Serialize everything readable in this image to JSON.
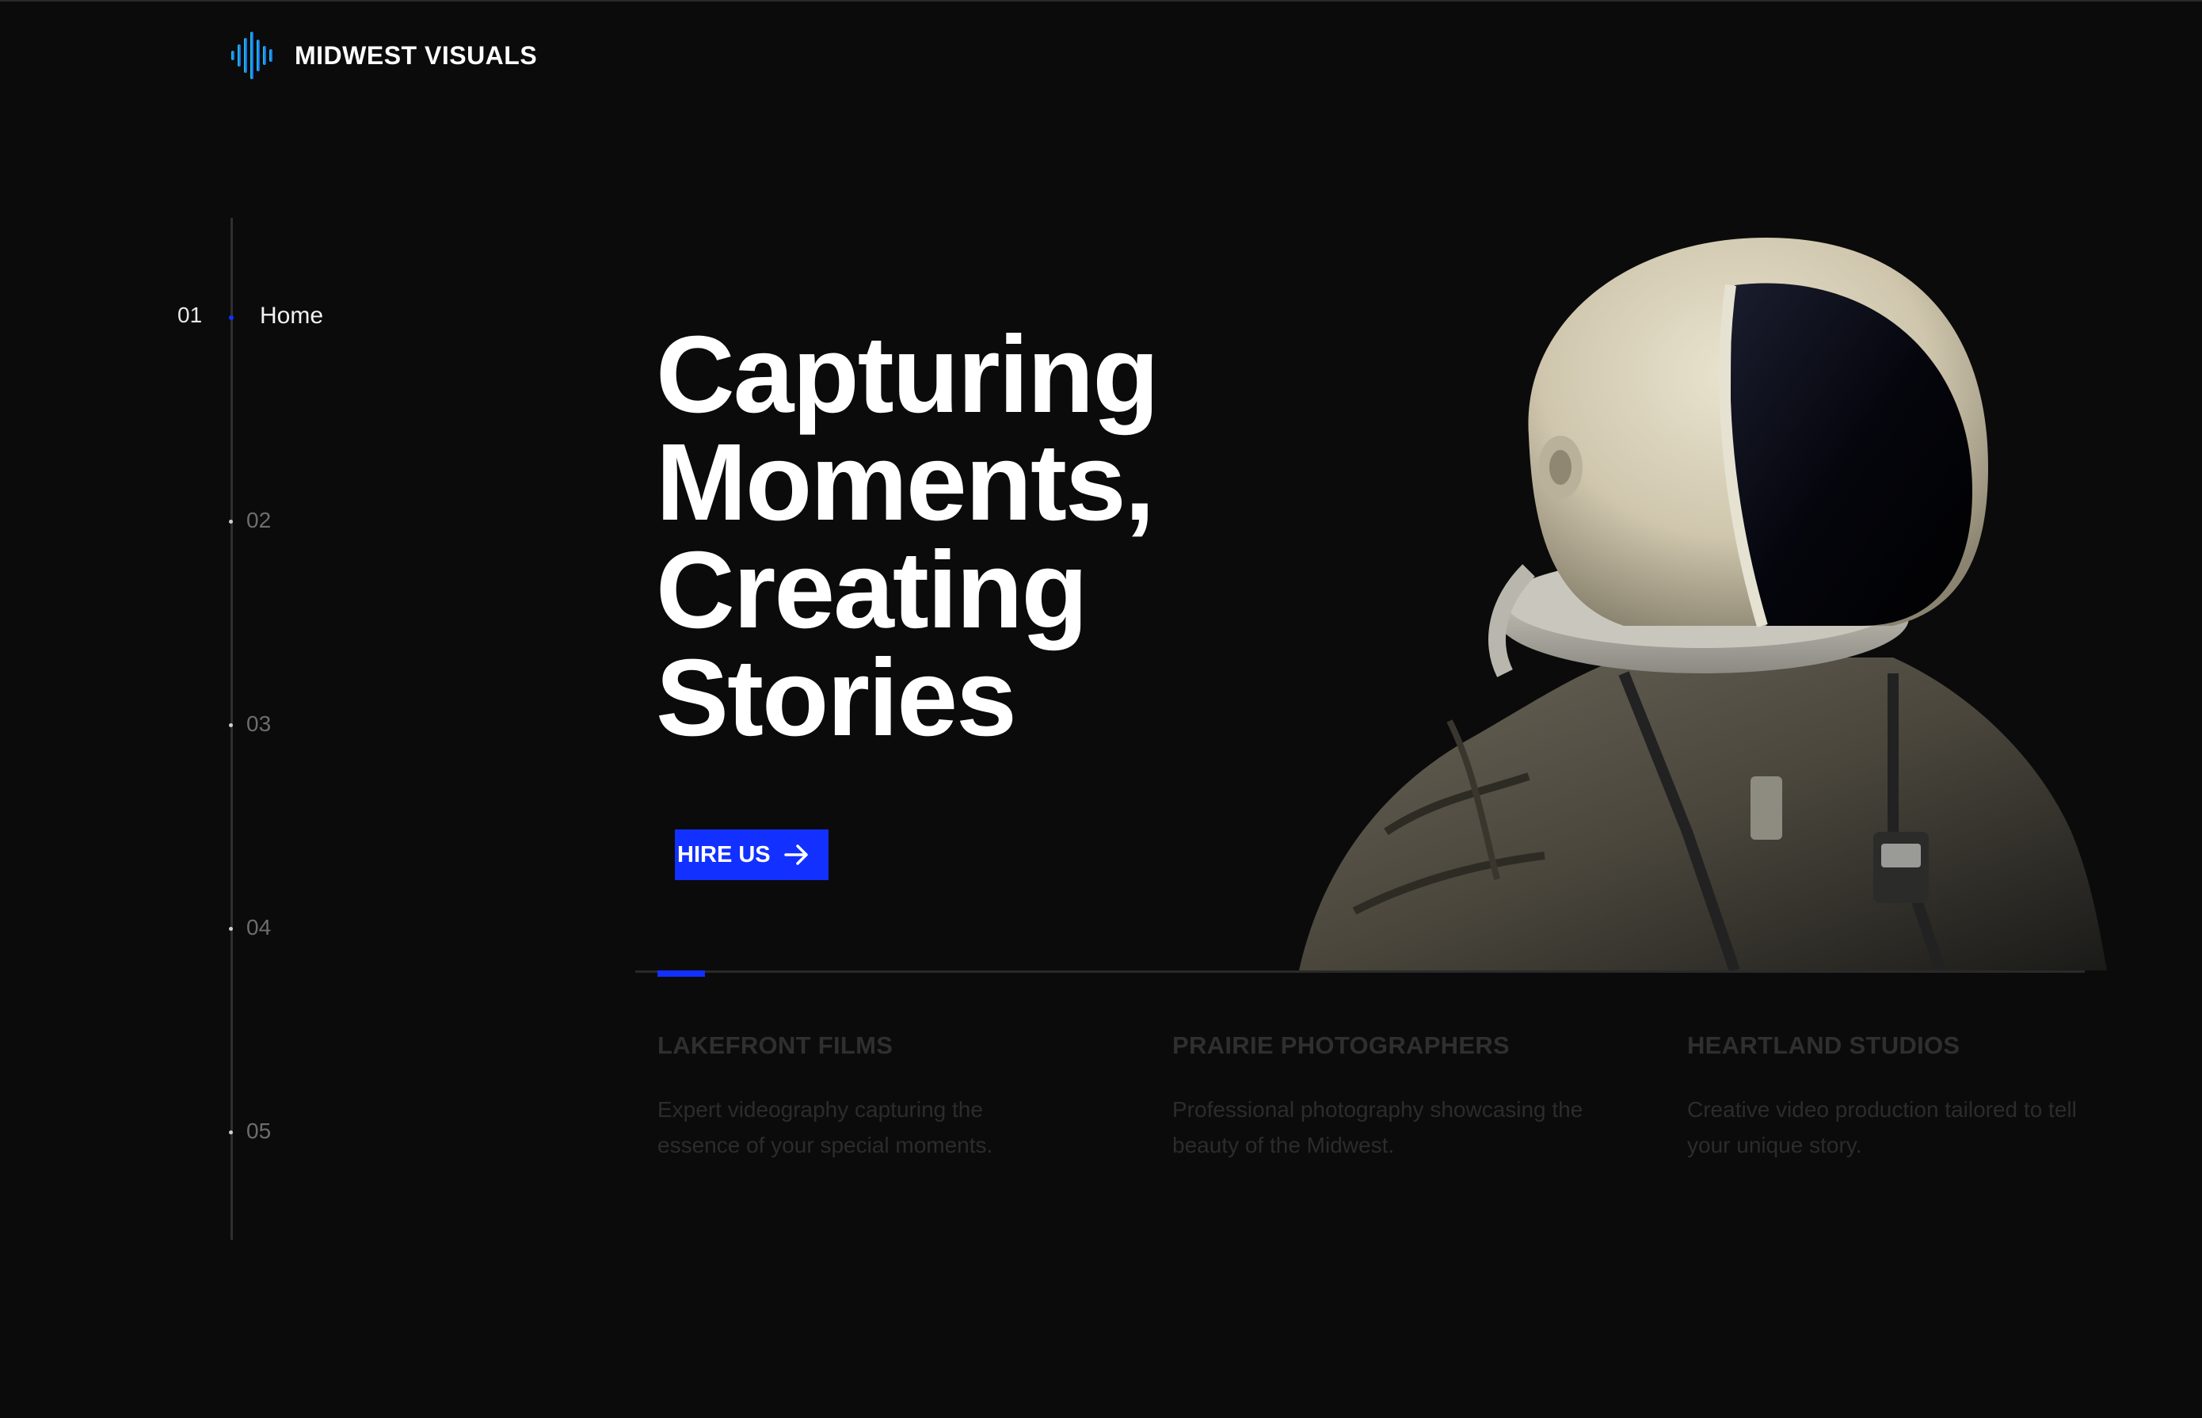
{
  "brand": {
    "name": "MIDWEST VISUALS",
    "accent": "#1230ff"
  },
  "nav": {
    "items": [
      {
        "num": "01",
        "label": "Home",
        "active": true
      },
      {
        "num": "02"
      },
      {
        "num": "03"
      },
      {
        "num": "04"
      },
      {
        "num": "05"
      }
    ]
  },
  "hero": {
    "lines": [
      "Capturing",
      "Moments,",
      "Creating",
      "Stories"
    ],
    "cta_label": "HIRE US",
    "cta_icon": "arrow-right-icon",
    "image": "astronaut-photo"
  },
  "cards": [
    {
      "title": "LAKEFRONT FILMS",
      "desc": "Expert videography capturing the essence of your special moments."
    },
    {
      "title": "PRAIRIE PHOTOGRAPHERS",
      "desc": "Professional photography showcasing the beauty of the Midwest."
    },
    {
      "title": "HEARTLAND STUDIOS",
      "desc": "Creative video production tailored to tell your unique story."
    }
  ]
}
